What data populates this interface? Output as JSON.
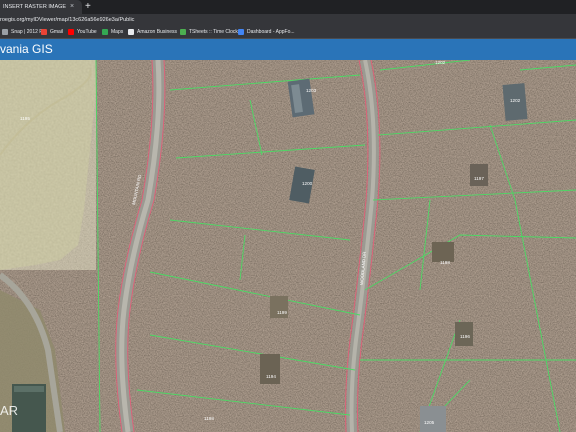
{
  "browser": {
    "tab_title": "INSERT RASTER IMAGE IN AUTOC",
    "tab_close": "×",
    "new_tab": "+",
    "url": "roegis.org/myIDViewer/map/13c626a56e926e3a/Public",
    "bookmarks": [
      {
        "label": "Snap | 2012 R...",
        "icon": "page-icon",
        "color": "#9aa0a6"
      },
      {
        "label": "Gmail",
        "icon": "gmail-icon",
        "color": "#ea4335"
      },
      {
        "label": "YouTube",
        "icon": "youtube-icon",
        "color": "#ff0000"
      },
      {
        "label": "Maps",
        "icon": "maps-icon",
        "color": "#34a853"
      },
      {
        "label": "Amazon Business",
        "icon": "amazon-icon",
        "color": "#e8eaed"
      },
      {
        "label": "TSheets :: Time Clock",
        "icon": "tsheets-icon",
        "color": "#4caf50"
      },
      {
        "label": "Dashboard - AppFo...",
        "icon": "appfolio-icon",
        "color": "#4285f4"
      }
    ]
  },
  "app": {
    "title": "vania GIS",
    "header_color": "#2a74b8"
  },
  "map": {
    "parcel_labels": [
      "1203",
      "1202",
      "1200",
      "1202",
      "1197",
      "1198",
      "1199",
      "1194",
      "1195",
      "1196",
      "1205",
      "1198"
    ],
    "road_labels": [
      "MOUNTAIN RD",
      "WOODLAND DR"
    ],
    "parcel_line_color": "#4cd964",
    "road_line_color": "#e0607a",
    "watermark": "AR"
  }
}
